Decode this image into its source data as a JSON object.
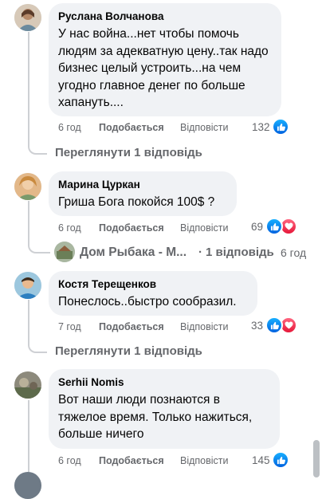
{
  "comments": [
    {
      "author": "Руслана Волчанова",
      "text": "У нас война...нет чтобы помочь людям за адекватную цену..так надо бизнес целый устроить...на чем угодно главное денег по больше хапануть....",
      "time": "6 год",
      "like_label": "Подобається",
      "reply_label": "Відповісти",
      "reactions_count": "132",
      "reactions": [
        "like"
      ],
      "replies_label": "Переглянути 1 відповідь"
    },
    {
      "author": "Марина Цуркан",
      "text": "Гриша Бога покойся 100$ ?",
      "time": "6 год",
      "like_label": "Подобається",
      "reply_label": "Відповісти",
      "reactions_count": "69",
      "reactions": [
        "like",
        "love"
      ],
      "reply_preview": {
        "author": "Дом Рыбака - М...",
        "separator": "·",
        "replies_label": "1 відповідь",
        "time": "6 год"
      }
    },
    {
      "author": "Костя Терещенков",
      "text": "Понеслось..быстро сообразил.",
      "time": "7 год",
      "like_label": "Подобається",
      "reply_label": "Відповісти",
      "reactions_count": "33",
      "reactions": [
        "like",
        "love"
      ],
      "replies_label": "Переглянути 1 відповідь"
    },
    {
      "author": "Serhii Nomis",
      "text": "Вот наши люди познаются в тяжелое время. Только нажиться, больше ничего",
      "time": "6 год",
      "like_label": "Подобається",
      "reply_label": "Відповісти",
      "reactions_count": "145",
      "reactions": [
        "like"
      ]
    }
  ],
  "colors": {
    "bubble": "#f0f2f5",
    "meta_text": "#65676b",
    "like_blue": "#1877f2",
    "love_red": "#f33e58"
  }
}
